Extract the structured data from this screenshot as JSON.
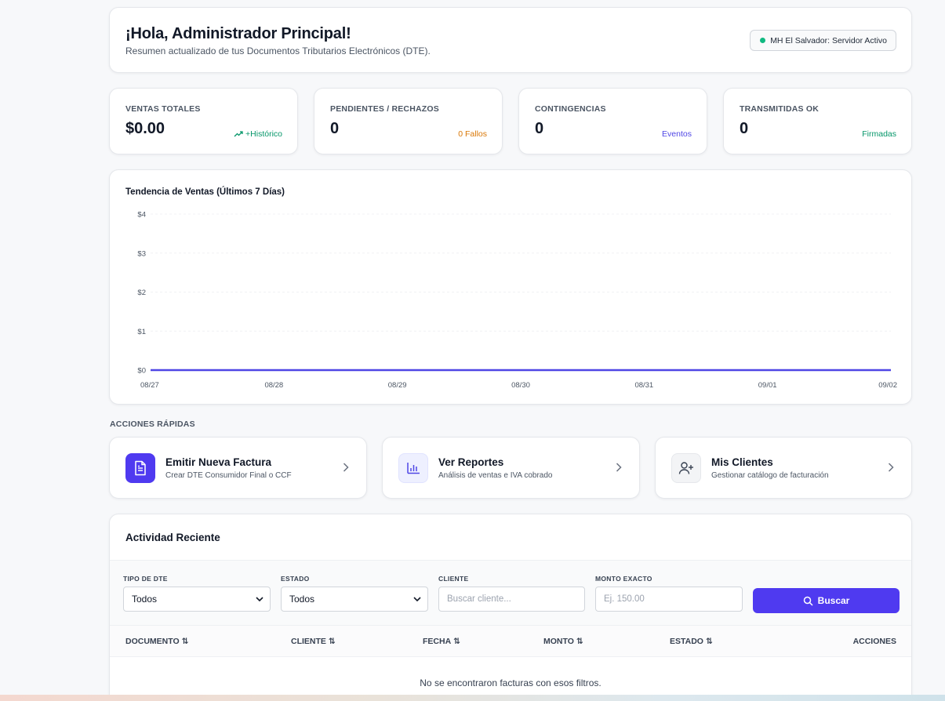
{
  "greeting": {
    "title": "¡Hola, Administrador Principal!",
    "subtitle": "Resumen actualizado de tus Documentos Tributarios Electrónicos (DTE).",
    "status": "MH El Salvador: Servidor Activo"
  },
  "stats": [
    {
      "label": "VENTAS TOTALES",
      "value": "$0.00",
      "meta": "+Histórico",
      "meta_color": "#059669"
    },
    {
      "label": "PENDIENTES / RECHAZOS",
      "value": "0",
      "meta": "0 Fallos",
      "meta_color": "#d97706"
    },
    {
      "label": "CONTINGENCIAS",
      "value": "0",
      "meta": "Eventos",
      "meta_color": "#4f46e5"
    },
    {
      "label": "TRANSMITIDAS OK",
      "value": "0",
      "meta": "Firmadas",
      "meta_color": "#059669"
    }
  ],
  "chart_data": {
    "type": "line",
    "title": "Tendencia de Ventas (Últimos 7 Días)",
    "categories": [
      "08/27",
      "08/28",
      "08/29",
      "08/30",
      "08/31",
      "09/01",
      "09/02"
    ],
    "values": [
      0,
      0,
      0,
      0,
      0,
      0,
      0
    ],
    "y_ticks": [
      "$0",
      "$1",
      "$2",
      "$3",
      "$4"
    ],
    "ylim": [
      0,
      4
    ],
    "grid": true,
    "line_color": "#4f46e5"
  },
  "quick_actions": {
    "label": "ACCIONES RÁPIDAS",
    "items": [
      {
        "title": "Emitir Nueva Factura",
        "subtitle": "Crear DTE Consumidor Final o CCF",
        "icon": "document-icon"
      },
      {
        "title": "Ver Reportes",
        "subtitle": "Análisis de ventas e IVA cobrado",
        "icon": "bar-chart-icon"
      },
      {
        "title": "Mis Clientes",
        "subtitle": "Gestionar catálogo de facturación",
        "icon": "user-plus-icon"
      }
    ]
  },
  "recent": {
    "title": "Actividad Reciente",
    "filters": {
      "tipo_label": "TIPO DE DTE",
      "tipo_value": "Todos",
      "estado_label": "ESTADO",
      "estado_value": "Todos",
      "cliente_label": "CLIENTE",
      "cliente_placeholder": "Buscar cliente...",
      "monto_label": "MONTO EXACTO",
      "monto_placeholder": "Ej. 150.00",
      "search_label": "Buscar"
    },
    "columns": [
      "DOCUMENTO",
      "CLIENTE",
      "FECHA",
      "MONTO",
      "ESTADO",
      "ACCIONES"
    ],
    "empty": "No se encontraron facturas con esos filtros."
  }
}
